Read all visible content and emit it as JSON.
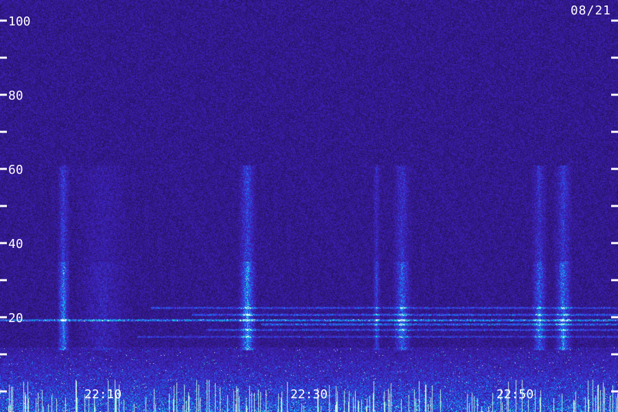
{
  "chart_data": {
    "type": "heatmap",
    "title": "",
    "date": "08/21",
    "y_axis": {
      "range": [
        0,
        100
      ],
      "major_ticks": [
        20,
        40,
        60,
        80,
        100
      ],
      "major_labels": [
        "20",
        "40",
        "60",
        "80",
        "100"
      ],
      "minor_ticks": [
        10,
        30,
        50,
        70,
        90
      ]
    },
    "x_axis": {
      "range": [
        "22:00",
        "23:00"
      ],
      "labels": [
        "22:10",
        "22:30",
        "22:50"
      ]
    },
    "colors": {
      "background": "#24105a",
      "low": "#3a1a8a",
      "mid": "#2a5cff",
      "high": "#00e6c8",
      "peak": "#ffffff"
    }
  }
}
